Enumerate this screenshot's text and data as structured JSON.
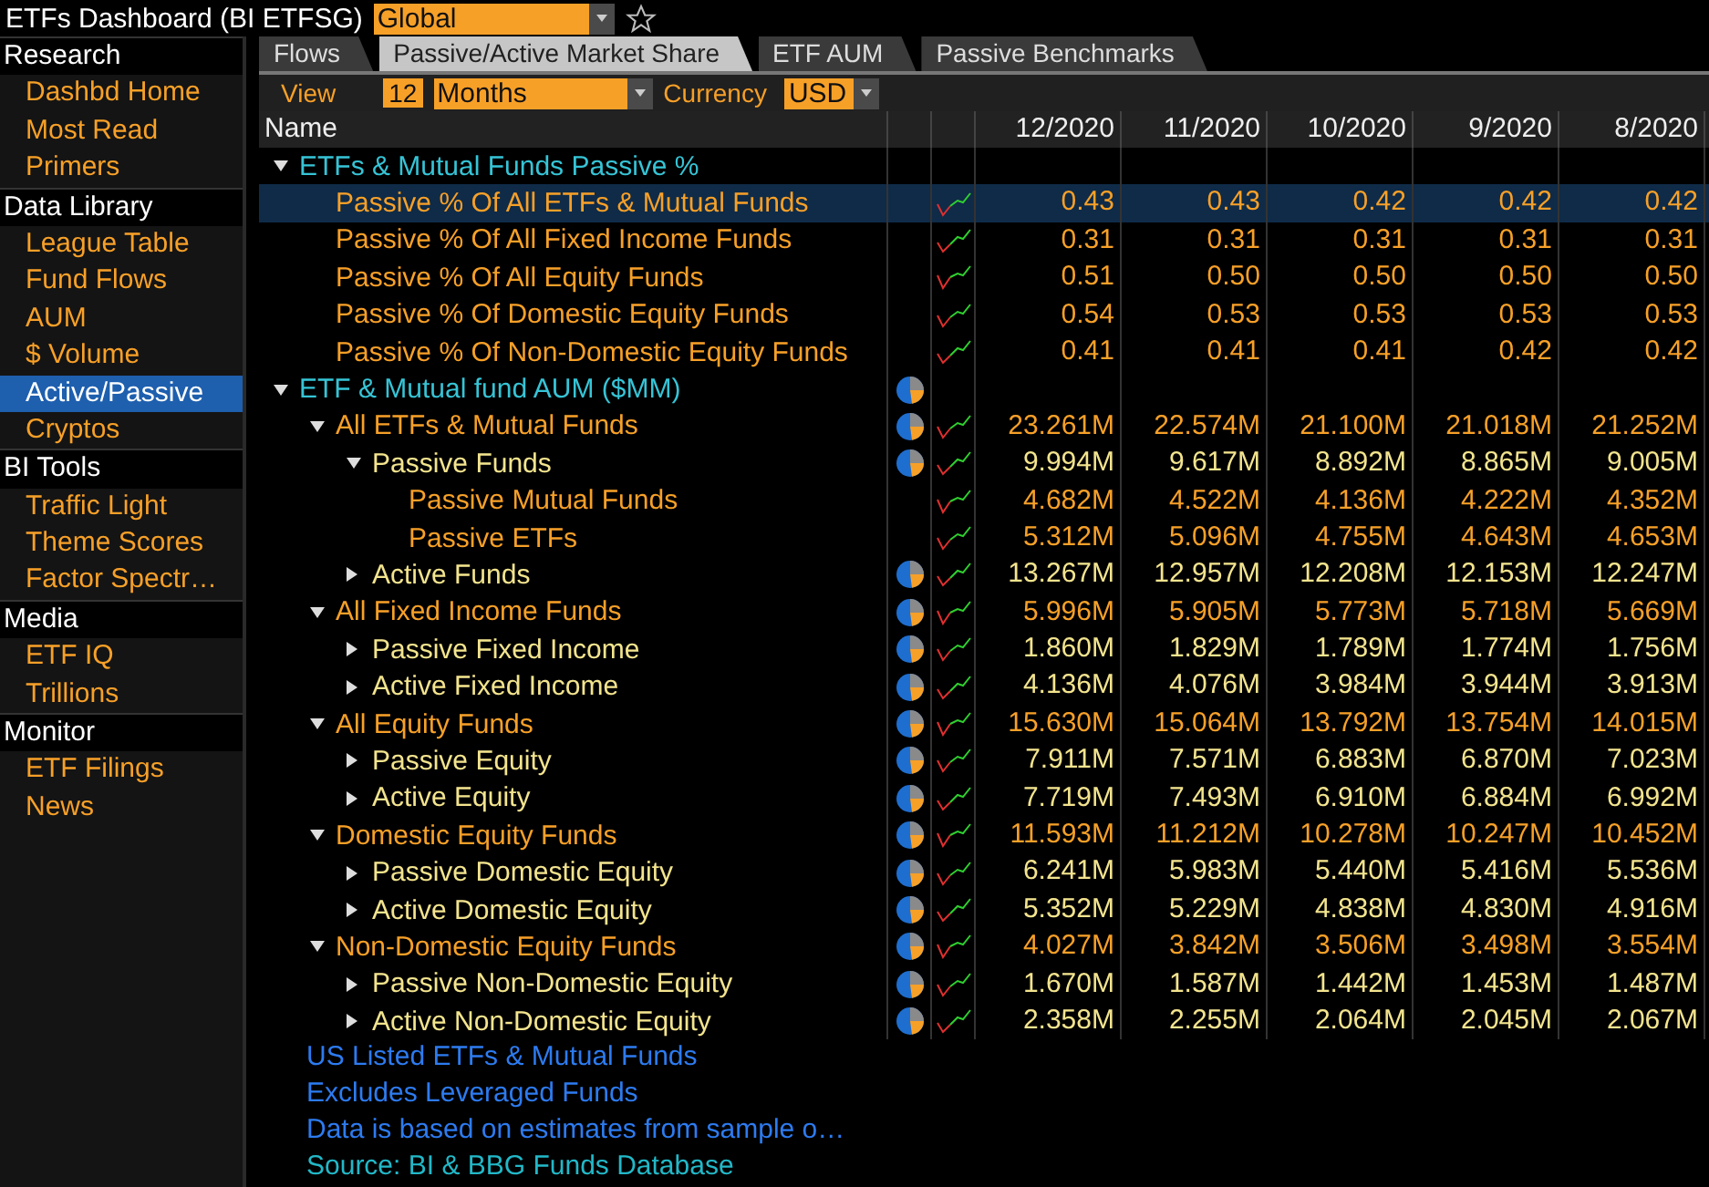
{
  "title": "ETFs Dashboard (BI ETFSG)",
  "region_select": {
    "value": "Global"
  },
  "sidebar": [
    {
      "heading": "Research",
      "items": [
        {
          "label": "Dashbd Home",
          "selected": false
        },
        {
          "label": "Most Read",
          "selected": false
        },
        {
          "label": "Primers",
          "selected": false
        }
      ]
    },
    {
      "heading": "Data Library",
      "items": [
        {
          "label": "League Table",
          "selected": false
        },
        {
          "label": "Fund Flows",
          "selected": false
        },
        {
          "label": "AUM",
          "selected": false
        },
        {
          "label": "$ Volume",
          "selected": false
        },
        {
          "label": "Active/Passive",
          "selected": true
        },
        {
          "label": "Cryptos",
          "selected": false
        }
      ]
    },
    {
      "heading": "BI Tools",
      "items": [
        {
          "label": "Traffic Light",
          "selected": false
        },
        {
          "label": "Theme Scores",
          "selected": false
        },
        {
          "label": "Factor Spectr…",
          "selected": false
        }
      ]
    },
    {
      "heading": "Media",
      "items": [
        {
          "label": "ETF IQ",
          "selected": false
        },
        {
          "label": "Trillions",
          "selected": false
        }
      ]
    },
    {
      "heading": "Monitor",
      "items": [
        {
          "label": "ETF Filings",
          "selected": false
        },
        {
          "label": "News",
          "selected": false
        }
      ]
    }
  ],
  "tabs": [
    {
      "label": "Flows",
      "selected": false
    },
    {
      "label": "Passive/Active Market Share",
      "selected": true
    },
    {
      "label": "ETF AUM",
      "selected": false
    },
    {
      "label": "Passive Benchmarks",
      "selected": false
    }
  ],
  "filters": {
    "view_label": "View",
    "period_count": "12",
    "period_unit": "Months",
    "currency_label": "Currency",
    "currency": "USD"
  },
  "table": {
    "columns": [
      "Name",
      "12/2020",
      "11/2020",
      "10/2020",
      "9/2020",
      "8/2020"
    ],
    "rows": [
      {
        "label": "ETFs & Mutual Funds Passive %",
        "expanded": true,
        "pie": false,
        "selected": false,
        "children": [
          {
            "label": "Passive % Of All ETFs & Mutual Funds",
            "pie": false,
            "selected": true,
            "values": [
              "0.43",
              "0.43",
              "0.42",
              "0.42",
              "0.42"
            ]
          },
          {
            "label": "Passive % Of All Fixed Income Funds",
            "pie": false,
            "selected": false,
            "values": [
              "0.31",
              "0.31",
              "0.31",
              "0.31",
              "0.31"
            ]
          },
          {
            "label": "Passive % Of All Equity Funds",
            "pie": false,
            "selected": false,
            "values": [
              "0.51",
              "0.50",
              "0.50",
              "0.50",
              "0.50"
            ]
          },
          {
            "label": "Passive % Of Domestic Equity Funds",
            "pie": false,
            "selected": false,
            "values": [
              "0.54",
              "0.53",
              "0.53",
              "0.53",
              "0.53"
            ]
          },
          {
            "label": "Passive % Of Non-Domestic Equity Funds",
            "pie": false,
            "selected": false,
            "values": [
              "0.41",
              "0.41",
              "0.41",
              "0.42",
              "0.42"
            ]
          }
        ]
      },
      {
        "label": "ETF & Mutual fund AUM ($MM)",
        "expanded": true,
        "pie": true,
        "selected": false,
        "children": [
          {
            "label": "All ETFs & Mutual Funds",
            "expanded": true,
            "pie": true,
            "selected": false,
            "values": [
              "23.261M",
              "22.574M",
              "21.100M",
              "21.018M",
              "21.252M"
            ],
            "children": [
              {
                "label": "Passive Funds",
                "expanded": true,
                "pie": true,
                "selected": false,
                "values": [
                  "9.994M",
                  "9.617M",
                  "8.892M",
                  "8.865M",
                  "9.005M"
                ],
                "children": [
                  {
                    "label": "Passive Mutual Funds",
                    "pie": false,
                    "selected": false,
                    "values": [
                      "4.682M",
                      "4.522M",
                      "4.136M",
                      "4.222M",
                      "4.352M"
                    ]
                  },
                  {
                    "label": "Passive ETFs",
                    "pie": false,
                    "selected": false,
                    "values": [
                      "5.312M",
                      "5.096M",
                      "4.755M",
                      "4.643M",
                      "4.653M"
                    ]
                  }
                ]
              },
              {
                "label": "Active Funds",
                "expanded": false,
                "pie": true,
                "selected": false,
                "values": [
                  "13.267M",
                  "12.957M",
                  "12.208M",
                  "12.153M",
                  "12.247M"
                ]
              }
            ]
          },
          {
            "label": "All Fixed Income Funds",
            "expanded": true,
            "pie": true,
            "selected": false,
            "values": [
              "5.996M",
              "5.905M",
              "5.773M",
              "5.718M",
              "5.669M"
            ],
            "children": [
              {
                "label": "Passive Fixed Income",
                "expanded": false,
                "pie": true,
                "selected": false,
                "values": [
                  "1.860M",
                  "1.829M",
                  "1.789M",
                  "1.774M",
                  "1.756M"
                ]
              },
              {
                "label": "Active Fixed Income",
                "expanded": false,
                "pie": true,
                "selected": false,
                "values": [
                  "4.136M",
                  "4.076M",
                  "3.984M",
                  "3.944M",
                  "3.913M"
                ]
              }
            ]
          },
          {
            "label": "All Equity Funds",
            "expanded": true,
            "pie": true,
            "selected": false,
            "values": [
              "15.630M",
              "15.064M",
              "13.792M",
              "13.754M",
              "14.015M"
            ],
            "children": [
              {
                "label": "Passive Equity",
                "expanded": false,
                "pie": true,
                "selected": false,
                "values": [
                  "7.911M",
                  "7.571M",
                  "6.883M",
                  "6.870M",
                  "7.023M"
                ]
              },
              {
                "label": "Active Equity",
                "expanded": false,
                "pie": true,
                "selected": false,
                "values": [
                  "7.719M",
                  "7.493M",
                  "6.910M",
                  "6.884M",
                  "6.992M"
                ]
              }
            ]
          },
          {
            "label": "Domestic Equity Funds",
            "expanded": true,
            "pie": true,
            "selected": false,
            "values": [
              "11.593M",
              "11.212M",
              "10.278M",
              "10.247M",
              "10.452M"
            ],
            "children": [
              {
                "label": "Passive Domestic Equity",
                "expanded": false,
                "pie": true,
                "selected": false,
                "values": [
                  "6.241M",
                  "5.983M",
                  "5.440M",
                  "5.416M",
                  "5.536M"
                ]
              },
              {
                "label": "Active Domestic Equity",
                "expanded": false,
                "pie": true,
                "selected": false,
                "values": [
                  "5.352M",
                  "5.229M",
                  "4.838M",
                  "4.830M",
                  "4.916M"
                ]
              }
            ]
          },
          {
            "label": "Non-Domestic Equity Funds",
            "expanded": true,
            "pie": true,
            "selected": false,
            "values": [
              "4.027M",
              "3.842M",
              "3.506M",
              "3.498M",
              "3.554M"
            ],
            "children": [
              {
                "label": "Passive Non-Domestic Equity",
                "expanded": false,
                "pie": true,
                "selected": false,
                "values": [
                  "1.670M",
                  "1.587M",
                  "1.442M",
                  "1.453M",
                  "1.487M"
                ]
              },
              {
                "label": "Active Non-Domestic Equity",
                "expanded": false,
                "pie": true,
                "selected": false,
                "values": [
                  "2.358M",
                  "2.255M",
                  "2.064M",
                  "2.045M",
                  "2.067M"
                ]
              }
            ]
          }
        ]
      }
    ]
  },
  "notes": [
    {
      "kind": "note",
      "text": "US Listed ETFs & Mutual Funds"
    },
    {
      "kind": "note",
      "text": "Excludes Leveraged Funds"
    },
    {
      "kind": "note",
      "text": "Data is based on estimates from sample o…"
    },
    {
      "kind": "source",
      "text": "Source: BI & BBG Funds Database"
    }
  ]
}
